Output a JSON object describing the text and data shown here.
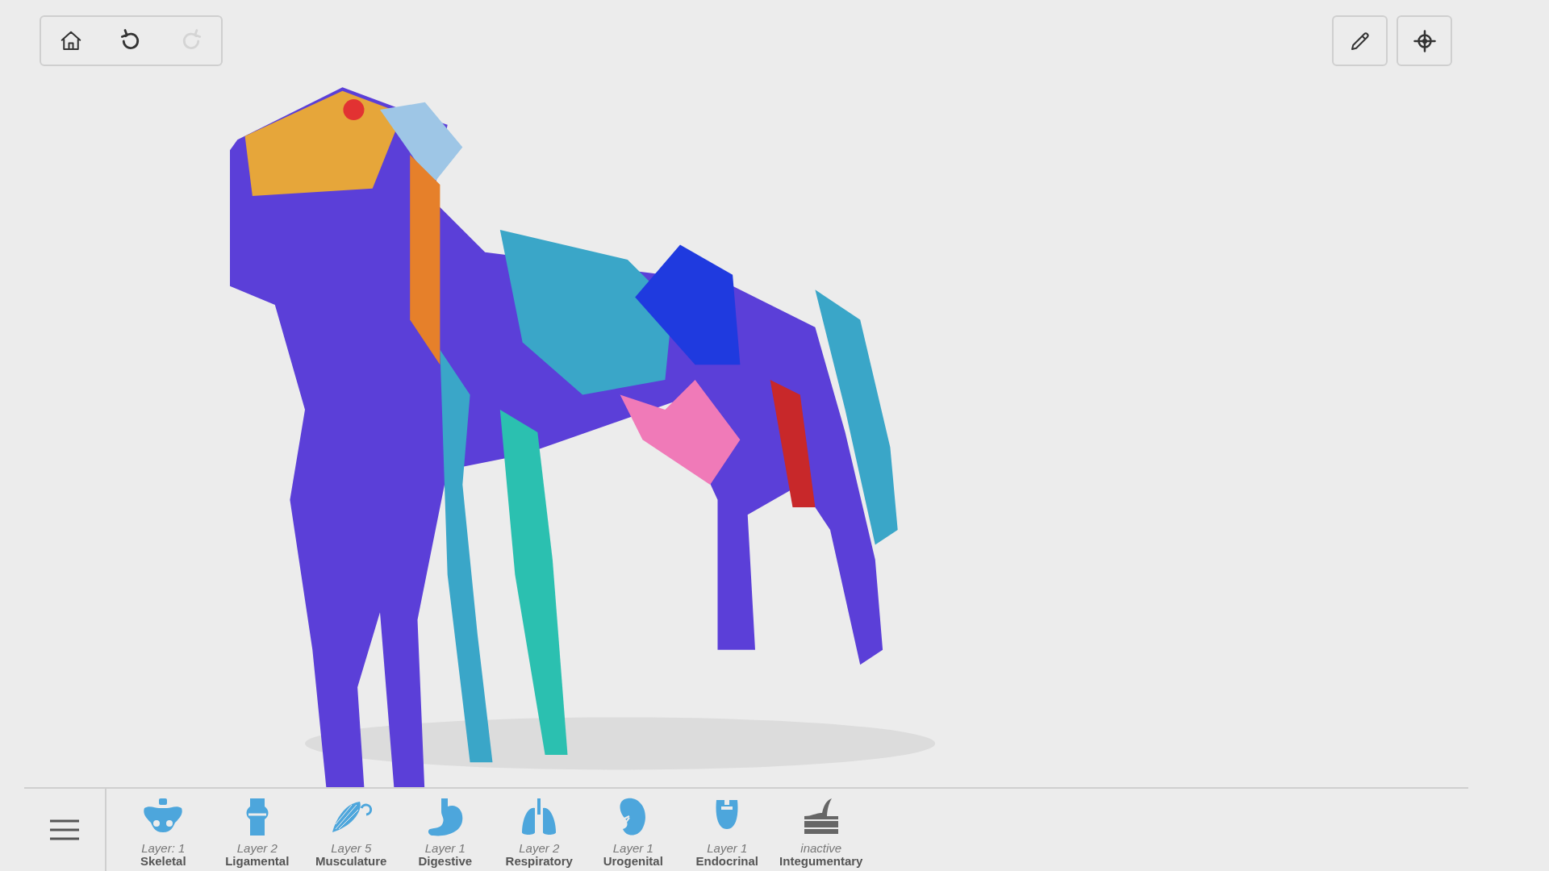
{
  "toolbar": [
    {
      "kind": "home",
      "disabled": false
    },
    {
      "kind": "undo",
      "disabled": false
    },
    {
      "kind": "redo",
      "disabled": true
    }
  ],
  "tools": [
    {
      "kind": "pencil"
    },
    {
      "kind": "crosshair"
    }
  ],
  "layers": [
    {
      "kind": "skeletal",
      "status": "Layer: 1",
      "name": "Skeletal",
      "active": true
    },
    {
      "kind": "ligamental",
      "status": "Layer 2",
      "name": "Ligamental",
      "active": true
    },
    {
      "kind": "musculature",
      "status": "Layer 5",
      "name": "Musculature",
      "active": true
    },
    {
      "kind": "digestive",
      "status": "Layer 1",
      "name": "Digestive",
      "active": true
    },
    {
      "kind": "respiratory",
      "status": "Layer 2",
      "name": "Respiratory",
      "active": true
    },
    {
      "kind": "urogenital",
      "status": "Layer 1",
      "name": "Urogenital",
      "active": true
    },
    {
      "kind": "endocrinal",
      "status": "Layer 1",
      "name": "Endocrinal",
      "active": true
    },
    {
      "kind": "integumentary",
      "status": "inactive",
      "name": "Integumentary",
      "active": false
    }
  ]
}
